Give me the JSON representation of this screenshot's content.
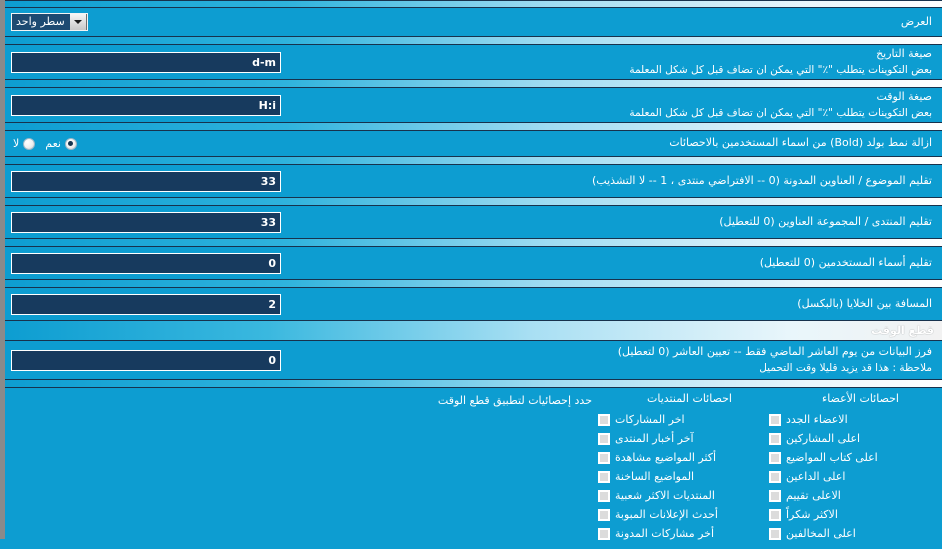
{
  "colors": {
    "background": "#0d9dd1",
    "field_bg": "#173a5e",
    "field_border": "#ffffff",
    "separator_dark": "#17324d",
    "left_border": "#8a8a8a"
  },
  "rows": {
    "display": {
      "label": "العرض",
      "select_value": "سطر واحد"
    },
    "date_format": {
      "label": "صيغة التاريخ",
      "desc": "بعض التكوينات يتطلب \"٪\" التي يمكن ان تضاف قبل كل شكل المعلمة",
      "value": "d-m"
    },
    "time_format": {
      "label": "صيغة الوقت",
      "desc": "بعض التكوينات يتطلب \"٪\" التي يمكن ان تضاف قبل كل شكل المعلمة",
      "value": "H:i"
    },
    "remove_bold": {
      "label": "ازالة نمط بولد (Bold) من اسماء المستخدمين بالاحصائات",
      "options": [
        {
          "label": "نعم",
          "checked": true
        },
        {
          "label": "لا",
          "checked": false
        }
      ]
    },
    "trim_topic": {
      "label": "تقليم الموضوع / العناوين المدونة (0 -- الافتراضي منتدى ، 1 -- لا التشذيب)",
      "value": "33"
    },
    "trim_forum": {
      "label": "تقليم المنتدى / المجموعة العناوين (0 للتعطيل)",
      "value": "33"
    },
    "trim_username": {
      "label": "تقليم أسماء المستخدمين (0 للتعطيل)",
      "value": "0"
    },
    "cell_spacing": {
      "label": "المسافة بين الخلايا (بالبكسل)",
      "value": "2"
    }
  },
  "time_cut_section": {
    "title": "قطع الوقت",
    "cutoff": {
      "label": "فرز البيانات من يوم العاشر الماضي فقط -- تعيين العاشر (0 لتعطيل)",
      "desc": "ملاحظة : هذا قد يزيد قليلا وقت التحميل",
      "value": "0"
    },
    "stats_selector": {
      "label": "حدد إحصائيات لتطبيق قطع الوقت",
      "columns": [
        {
          "header": "احصائات الأعضاء",
          "items": [
            {
              "label": "الاعضاء الجدد",
              "checked": false
            },
            {
              "label": "اعلى المشاركين",
              "checked": false
            },
            {
              "label": "اعلى كتاب المواضيع",
              "checked": false
            },
            {
              "label": "اعلى الداعين",
              "checked": false
            },
            {
              "label": "الاعلى تقييم",
              "checked": false
            },
            {
              "label": "الاكثر شكراً",
              "checked": false
            },
            {
              "label": "اعلى المخالفين",
              "checked": false
            }
          ]
        },
        {
          "header": "احصائات المنتديات",
          "items": [
            {
              "label": "اخر المشاركات",
              "checked": false
            },
            {
              "label": "آخر أخبار المنتدى",
              "checked": false
            },
            {
              "label": "أكثر المواضيع مشاهدة",
              "checked": false
            },
            {
              "label": "المواضيع الساخنة",
              "checked": false
            },
            {
              "label": "المنتديات الاكثر شعبية",
              "checked": false
            },
            {
              "label": "أحدث الإعلانات المبوبة",
              "checked": false
            },
            {
              "label": "أخر مشاركات المدونة",
              "checked": false
            }
          ]
        }
      ]
    }
  }
}
